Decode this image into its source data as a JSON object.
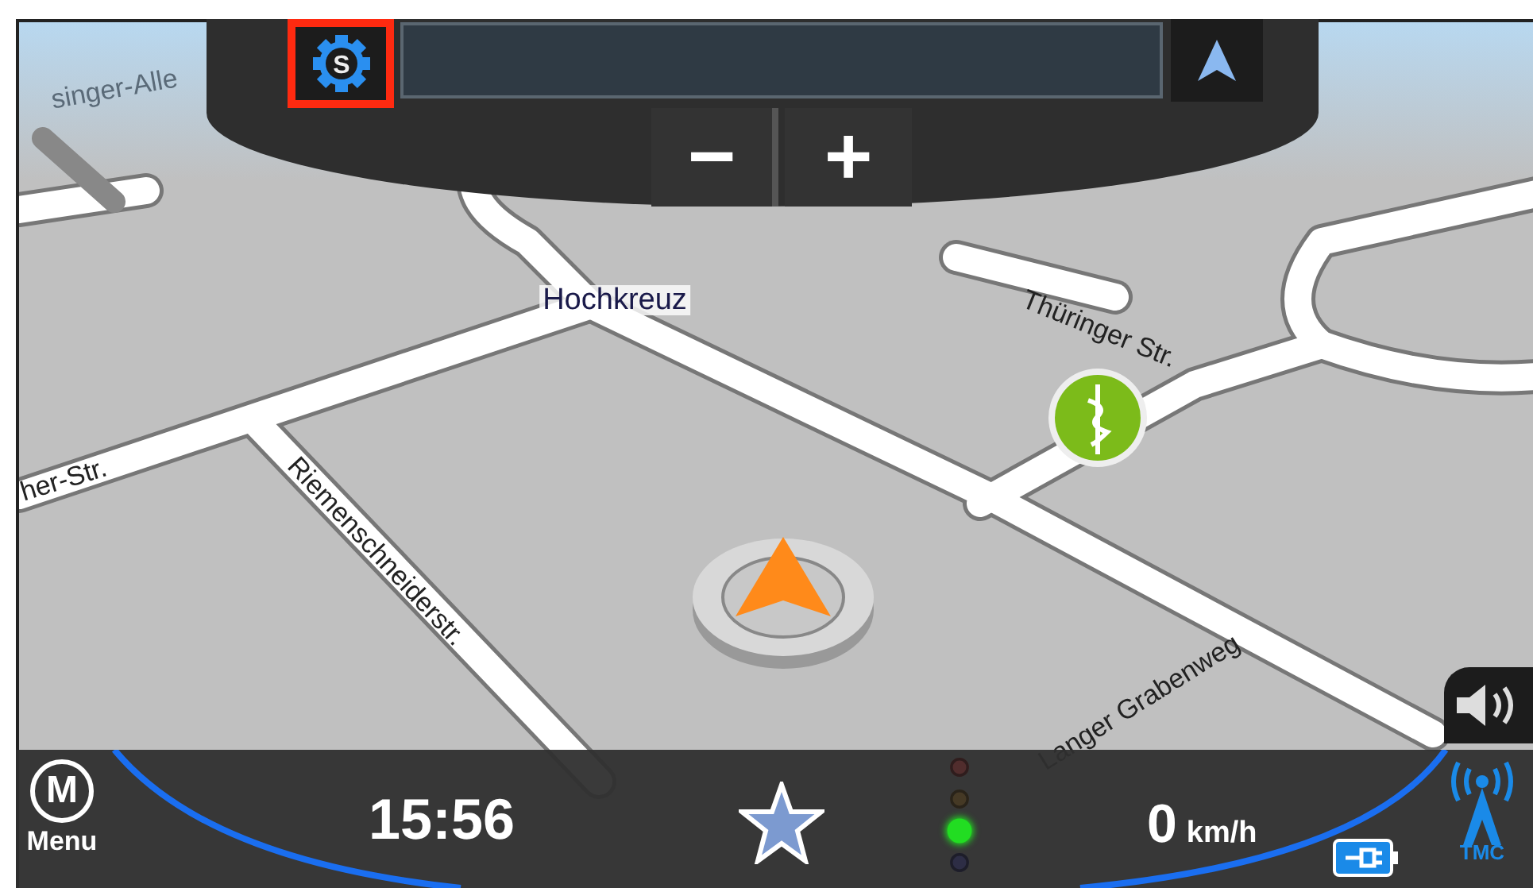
{
  "map": {
    "labels": [
      {
        "kind": "place",
        "text": "Hochkreuz"
      },
      {
        "kind": "street",
        "text": "Thüringer Str."
      },
      {
        "kind": "street",
        "text": "Riemenschneiderstr."
      },
      {
        "kind": "street",
        "text": "her-Str."
      },
      {
        "kind": "street",
        "text": "Langer Grabenweg"
      },
      {
        "kind": "faded",
        "text": "singer-Alle"
      }
    ]
  },
  "top_bar": {
    "settings_letter": "S",
    "settings_highlighted": true,
    "zoom_out": "−",
    "zoom_in": "+"
  },
  "bottom_bar": {
    "menu_letter": "M",
    "menu_label": "Menu",
    "time": "15:56",
    "speed": "0",
    "speed_unit": "km/h",
    "tmc_label": "TMC",
    "traffic_light": [
      {
        "color": "#5a2a2a",
        "on": false
      },
      {
        "color": "#4a3a20",
        "on": false
      },
      {
        "color": "#22dd22",
        "on": true
      },
      {
        "color": "#2a2a4a",
        "on": false
      }
    ]
  }
}
